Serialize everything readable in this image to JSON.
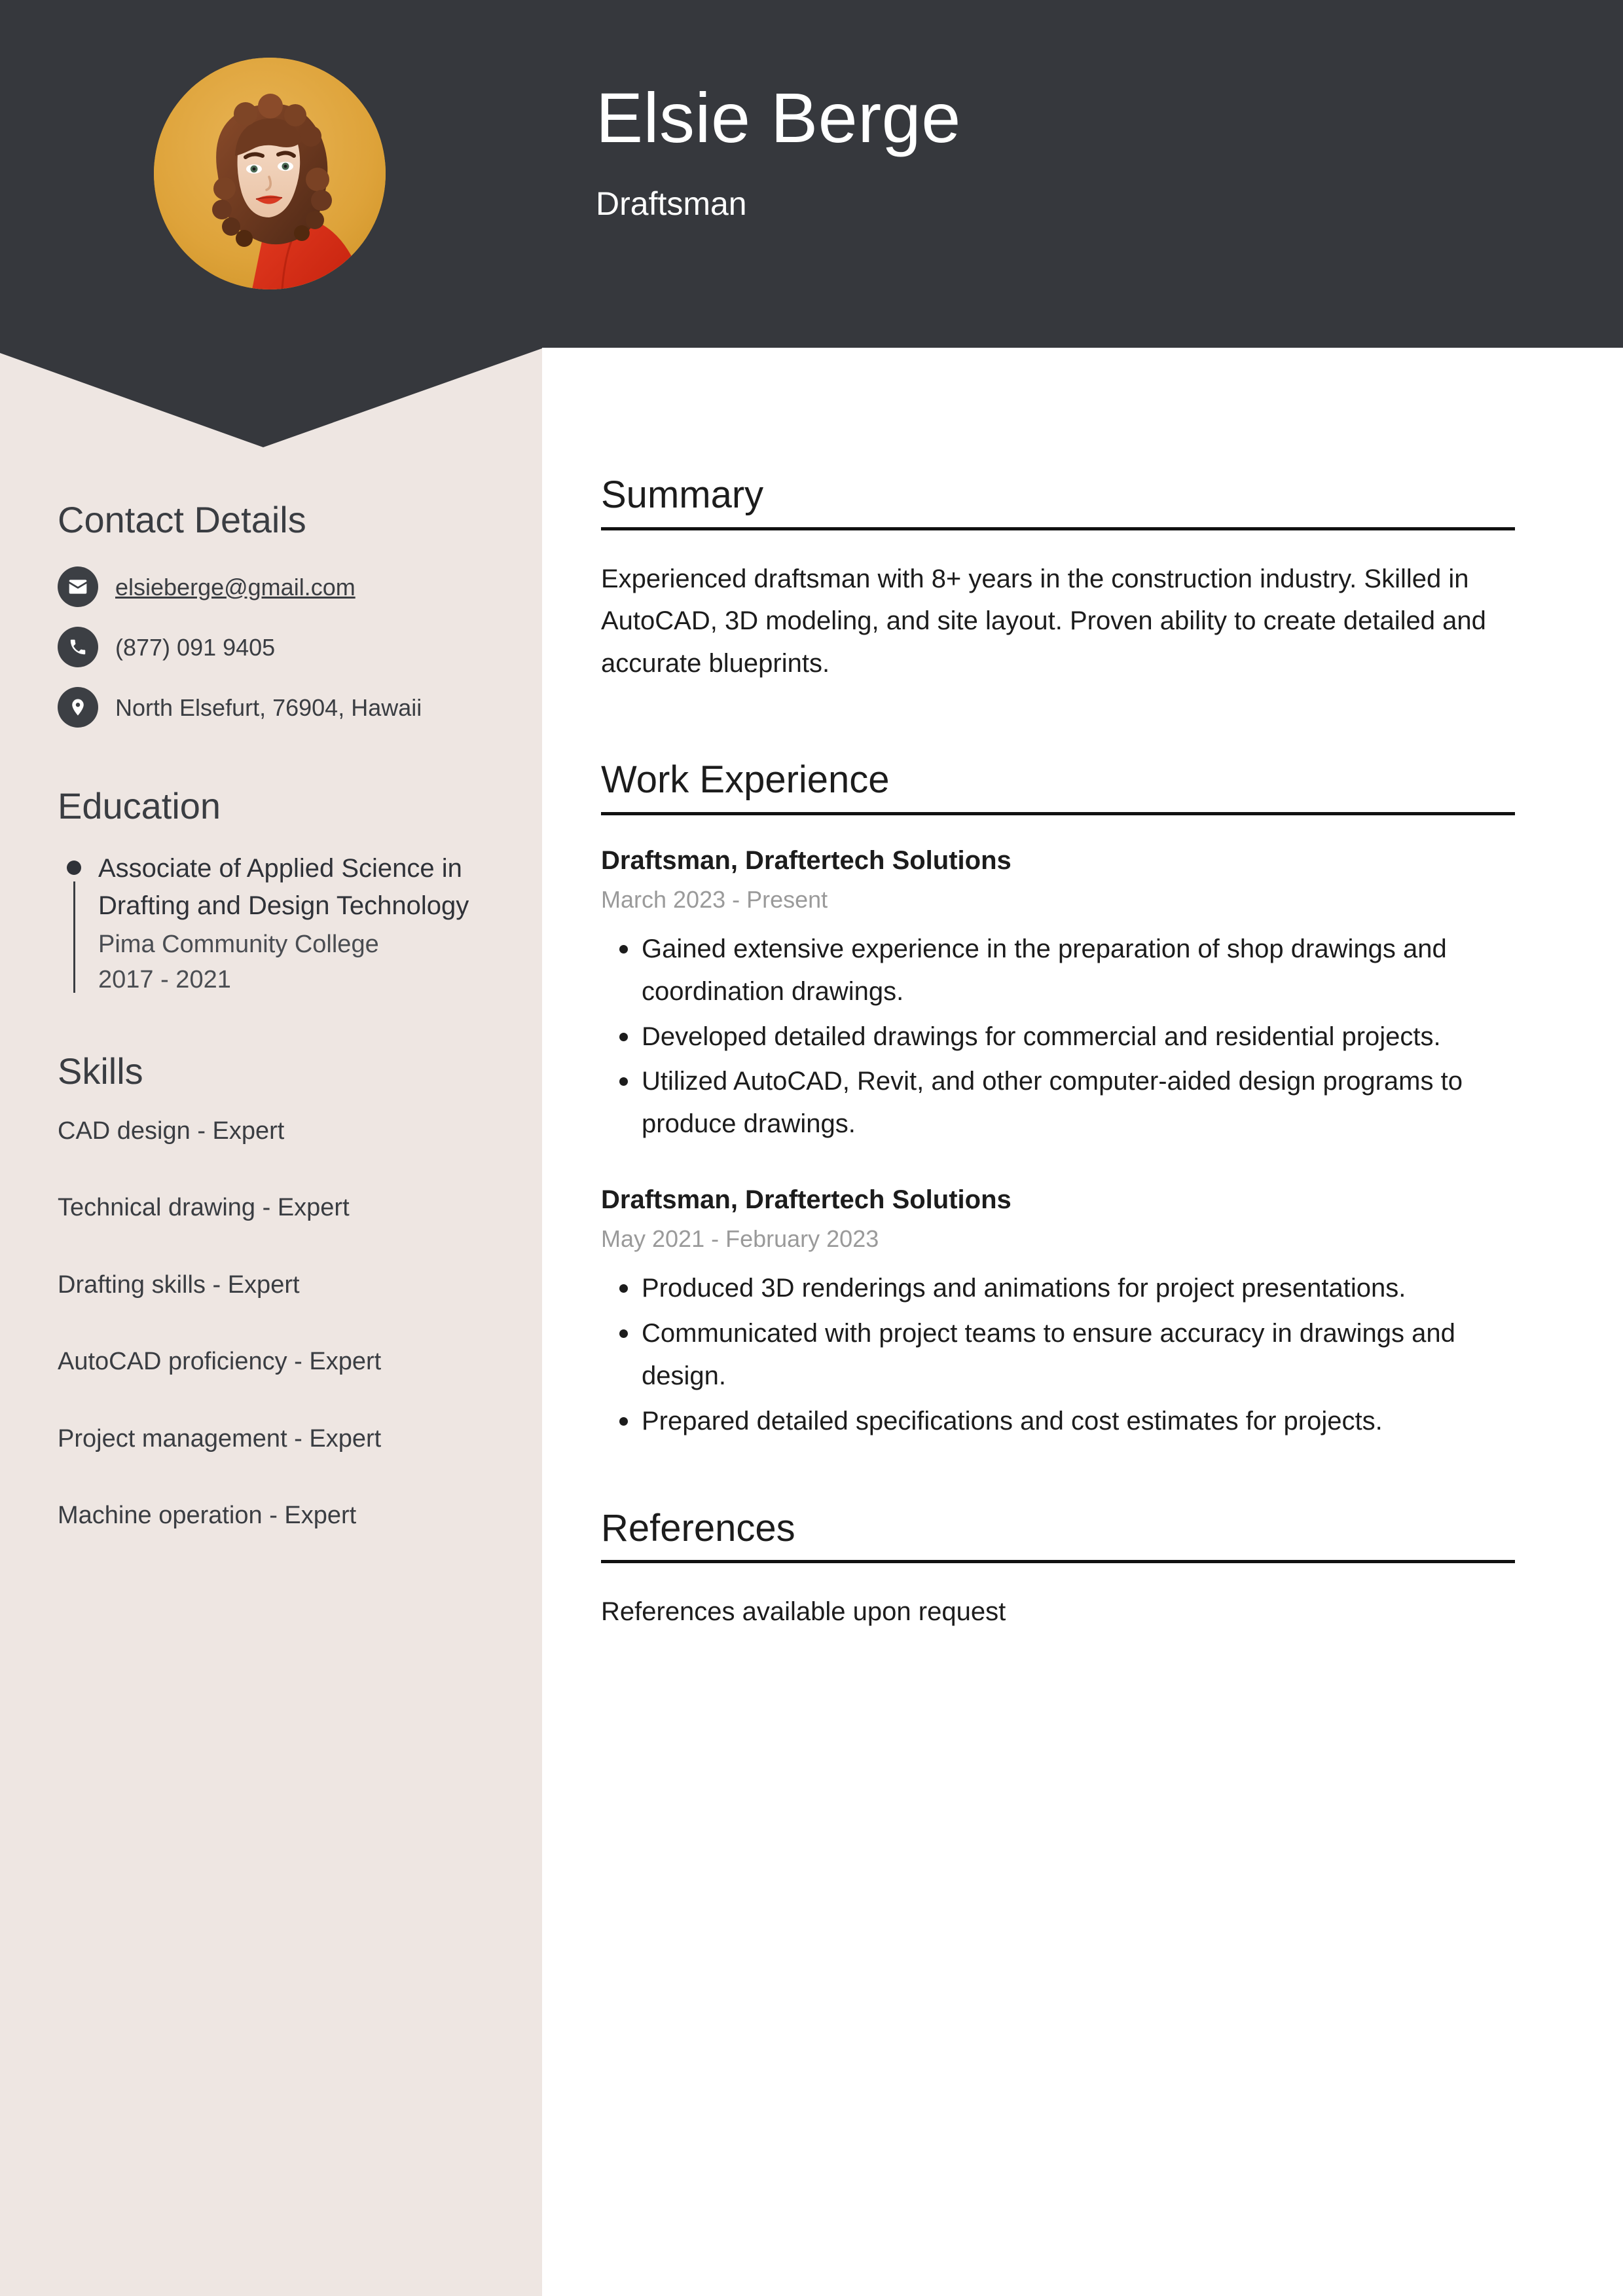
{
  "theme": {
    "header_bg": "#36383D",
    "sidebar_bg": "#EEE6E2",
    "main_bg": "#FFFFFF",
    "photo_bg": "#E0A63A",
    "accent_text": "#1C1C1C",
    "muted_text": "#9A9A9A"
  },
  "header": {
    "name": "Elsie Berge",
    "job_title": "Draftsman"
  },
  "sidebar": {
    "contact": {
      "heading": "Contact Details",
      "items": [
        {
          "icon": "envelope-icon",
          "value": "elsieberge@gmail.com",
          "link": true
        },
        {
          "icon": "phone-icon",
          "value": "(877) 091 9405",
          "link": false
        },
        {
          "icon": "location-pin-icon",
          "value": "North Elsefurt, 76904, Hawaii",
          "link": false
        }
      ]
    },
    "education": {
      "heading": "Education",
      "items": [
        {
          "degree": "Associate of Applied Science in Drafting and Design Technology",
          "school": "Pima Community College",
          "dates": "2017 - 2021"
        }
      ]
    },
    "skills": {
      "heading": "Skills",
      "items": [
        "CAD design - Expert",
        "Technical drawing - Expert",
        "Drafting skills - Expert",
        "AutoCAD proficiency - Expert",
        "Project management - Expert",
        "Machine operation - Expert"
      ]
    }
  },
  "main": {
    "summary": {
      "heading": "Summary",
      "text": "Experienced draftsman with 8+ years in the construction industry. Skilled in AutoCAD, 3D modeling, and site layout. Proven ability to create detailed and accurate blueprints."
    },
    "work_experience": {
      "heading": "Work Experience",
      "jobs": [
        {
          "title": "Draftsman, Draftertech Solutions",
          "dates": "March 2023 - Present",
          "bullets": [
            "Gained extensive experience in the preparation of shop drawings and coordination drawings.",
            "Developed detailed drawings for commercial and residential projects.",
            "Utilized AutoCAD, Revit, and other computer-aided design programs to produce drawings."
          ]
        },
        {
          "title": "Draftsman, Draftertech Solutions",
          "dates": "May 2021 - February 2023",
          "bullets": [
            "Produced 3D renderings and animations for project presentations.",
            "Communicated with project teams to ensure accuracy in drawings and design.",
            "Prepared detailed specifications and cost estimates for projects."
          ]
        }
      ]
    },
    "references": {
      "heading": "References",
      "text": "References available upon request"
    }
  }
}
